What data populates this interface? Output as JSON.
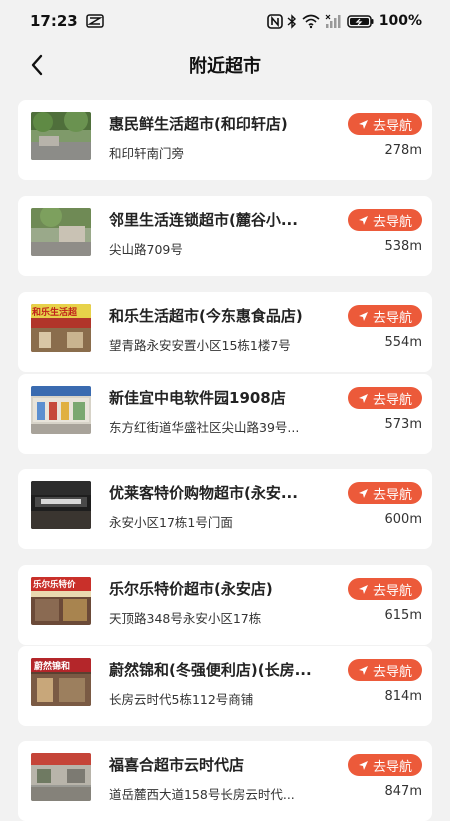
{
  "status_bar": {
    "time": "17:23",
    "battery": "100%"
  },
  "header": {
    "title": "附近超市"
  },
  "nav_label": "去导航",
  "accent_color": "#ec5a3a",
  "stores": [
    {
      "name": "惠民鲜生活超市(和印轩店)",
      "address": "和印轩南门旁",
      "distance": "278m"
    },
    {
      "name": "邻里生活连锁超市(麓谷小...",
      "address": "尖山路709号",
      "distance": "538m"
    },
    {
      "name": "和乐生活超市(今东惠食品店)",
      "address": "望青路永安安置小区15栋1楼7号",
      "distance": "554m"
    },
    {
      "name": "新佳宜中电软件园1908店",
      "address": "东方红街道华盛社区尖山路39号...",
      "distance": "573m"
    },
    {
      "name": "优莱客特价购物超市(永安...",
      "address": "永安小区17栋1号门面",
      "distance": "600m"
    },
    {
      "name": "乐尔乐特价超市(永安店)",
      "address": "天顶路348号永安小区17栋",
      "distance": "615m"
    },
    {
      "name": "蔚然锦和(冬强便利店)(长房...",
      "address": "长房云时代5栋112号商铺",
      "distance": "814m"
    },
    {
      "name": "福喜合超市云时代店",
      "address": "道岳麓西大道158号长房云时代...",
      "distance": "847m"
    }
  ],
  "thumb_signs": [
    "",
    "",
    "和乐生活超",
    "",
    "",
    "乐尔乐特价",
    "蔚然锦和",
    ""
  ]
}
